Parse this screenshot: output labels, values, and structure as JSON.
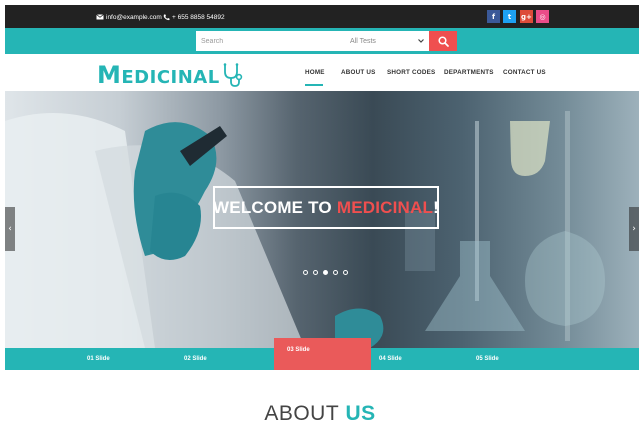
{
  "topbar": {
    "email": "info@example.com",
    "phone": "+ 655 8858 54892",
    "social": [
      {
        "icon": "facebook-icon",
        "glyph": "f",
        "color": "#3b5998"
      },
      {
        "icon": "twitter-icon",
        "glyph": "t",
        "color": "#1da1f2"
      },
      {
        "icon": "google-plus-icon",
        "glyph": "g+",
        "color": "#dd4b39"
      },
      {
        "icon": "dribbble-icon",
        "glyph": "◎",
        "color": "#ea4c89"
      }
    ]
  },
  "search": {
    "placeholder": "Search",
    "category_selected": "All Tests",
    "button_icon": "search-icon"
  },
  "logo": {
    "first_letter": "M",
    "rest": "EDICINAL",
    "icon": "stethoscope-icon"
  },
  "nav": {
    "items": [
      "HOME",
      "ABOUT US",
      "SHORT CODES",
      "DEPARTMENTS",
      "CONTACT US"
    ],
    "active": "HOME"
  },
  "hero": {
    "welcome_prefix": "WELCOME TO",
    "welcome_brand": "MEDICINAL",
    "welcome_suffix": "!",
    "dots_count": 5,
    "active_dot": 3,
    "prev_icon": "chevron-left-icon",
    "next_icon": "chevron-right-icon"
  },
  "slides": {
    "tabs": [
      "01 Slide",
      "02 Slide",
      "03 Slide",
      "04 Slide",
      "05 Slide"
    ],
    "active": "03 Slide"
  },
  "about": {
    "heading_prefix": "ABOUT",
    "heading_highlight": "US"
  },
  "colors": {
    "accent": "#25b5b5",
    "highlight": "#ef4f4f",
    "topbar": "#222222"
  }
}
